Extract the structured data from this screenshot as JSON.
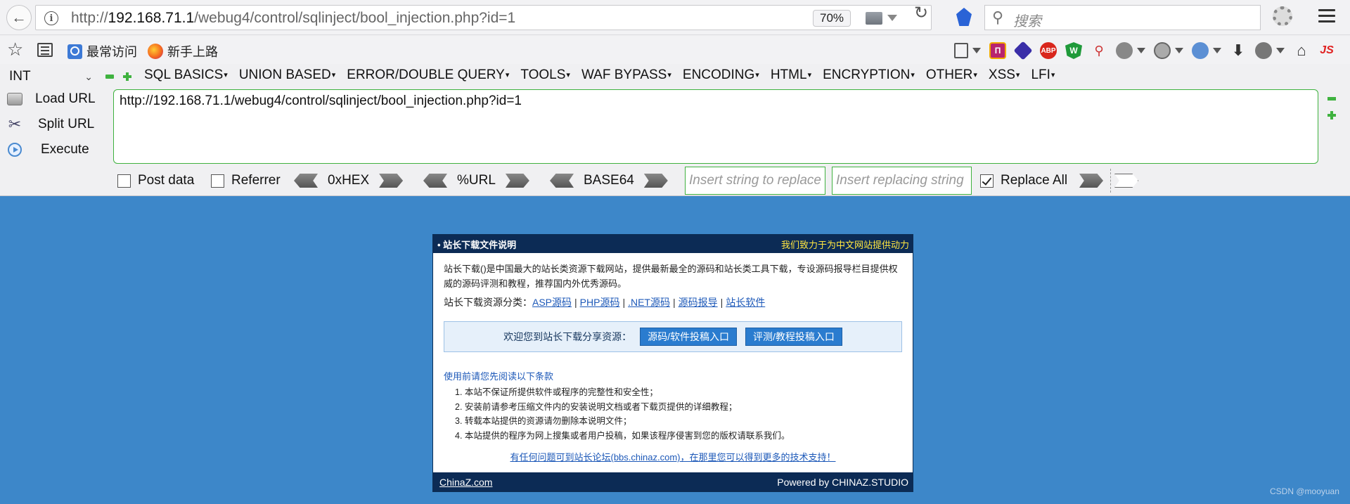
{
  "browser": {
    "url_prefix": "http://",
    "url_host": "192.168.71.1",
    "url_path": "/webug4/control/sqlinject/bool_injection.php?id=1",
    "zoom": "70%",
    "search_placeholder": "搜索"
  },
  "bookmarks": [
    {
      "label": "最常访问"
    },
    {
      "label": "新手上路"
    }
  ],
  "hackbar": {
    "select_value": "INT",
    "menu": [
      "SQL BASICS",
      "UNION BASED",
      "ERROR/DOUBLE QUERY",
      "TOOLS",
      "WAF BYPASS",
      "ENCODING",
      "HTML",
      "ENCRYPTION",
      "OTHER",
      "XSS",
      "LFI"
    ],
    "load_url": "Load URL",
    "split_url": "Split URL",
    "execute": "Execute",
    "url_value": "http://192.168.71.1/webug4/control/sqlinject/bool_injection.php?id=1",
    "post_data": "Post data",
    "referrer": "Referrer",
    "hex": "0xHEX",
    "urlenc": "%URL",
    "base64": "BASE64",
    "insert_placeholder": "Insert string to replace",
    "replacing_placeholder": "Insert replacing string",
    "replace_all": "Replace All",
    "replace_all_checked": true,
    "post_checked": false,
    "referrer_checked": false
  },
  "panel": {
    "title": "• 站长下载文件说明",
    "slogan": "我们致力于为中文网站提供动力",
    "intro": "站长下载()是中国最大的站长类资源下载网站，提供最新最全的源码和站长类工具下载，专设源码报导栏目提供权威的源码评测和教程，推荐国内外优秀源码。",
    "cat_label": "站长下载资源分类：",
    "categories": [
      "ASP源码",
      "PHP源码",
      ".NET源码",
      "源码报导",
      "站长软件"
    ],
    "welcome": "欢迎您到站长下载分享资源：",
    "btn1": "源码/软件投稿入口",
    "btn2": "评测/教程投稿入口",
    "notice_title": "使用前请您先阅读以下条款",
    "terms": [
      "1. 本站不保证所提供软件或程序的完整性和安全性；",
      "2. 安装前请参考压缩文件内的安装说明文档或者下载页提供的详细教程；",
      "3. 转载本站提供的资源请勿删除本说明文件；",
      "4. 本站提供的程序为网上搜集或者用户投稿，如果该程序侵害到您的版权请联系我们。"
    ],
    "support": "有任何问题可到站长论坛(bbs.chinaz.com)，在那里您可以得到更多的技术支持！",
    "footer_brand": "ChinaZ.com",
    "footer_powered": "Powered by CHINAZ.STUDIO"
  },
  "watermark": "CSDN @mooyuan"
}
